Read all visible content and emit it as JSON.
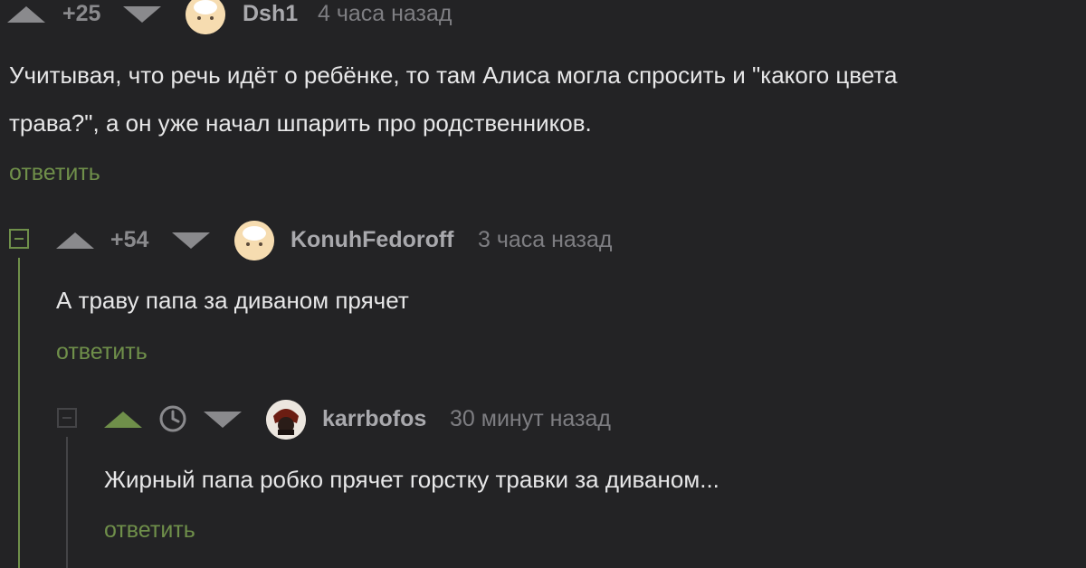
{
  "comments": [
    {
      "rating": "+25",
      "username": "Dsh1",
      "time": "4 часа назад",
      "text_lines": [
        "Учитывая, что речь идёт о ребёнке, то там Алиса могла спросить и \"какого цвета",
        "трава?\", а он уже начал шпарить про родственников."
      ],
      "reply_label": "ответить",
      "avatar": "chef-avatar"
    },
    {
      "rating": "+54",
      "username": "KonuhFedoroff",
      "time": "3 часа назад",
      "text_lines": [
        "А траву папа за диваном прячет"
      ],
      "reply_label": "ответить",
      "avatar": "chef-avatar"
    },
    {
      "rating_icon": "clock-icon",
      "username": "karrbofos",
      "time": "30 минут назад",
      "text_lines": [
        "Жирный папа робко прячет горстку травки за диваном..."
      ],
      "reply_label": "ответить",
      "avatar": "dark-avatar"
    }
  ],
  "colors": {
    "background": "#232325",
    "accent": "#6f8f4a",
    "text": "#e7e7e8",
    "muted": "#8a8a8d"
  }
}
